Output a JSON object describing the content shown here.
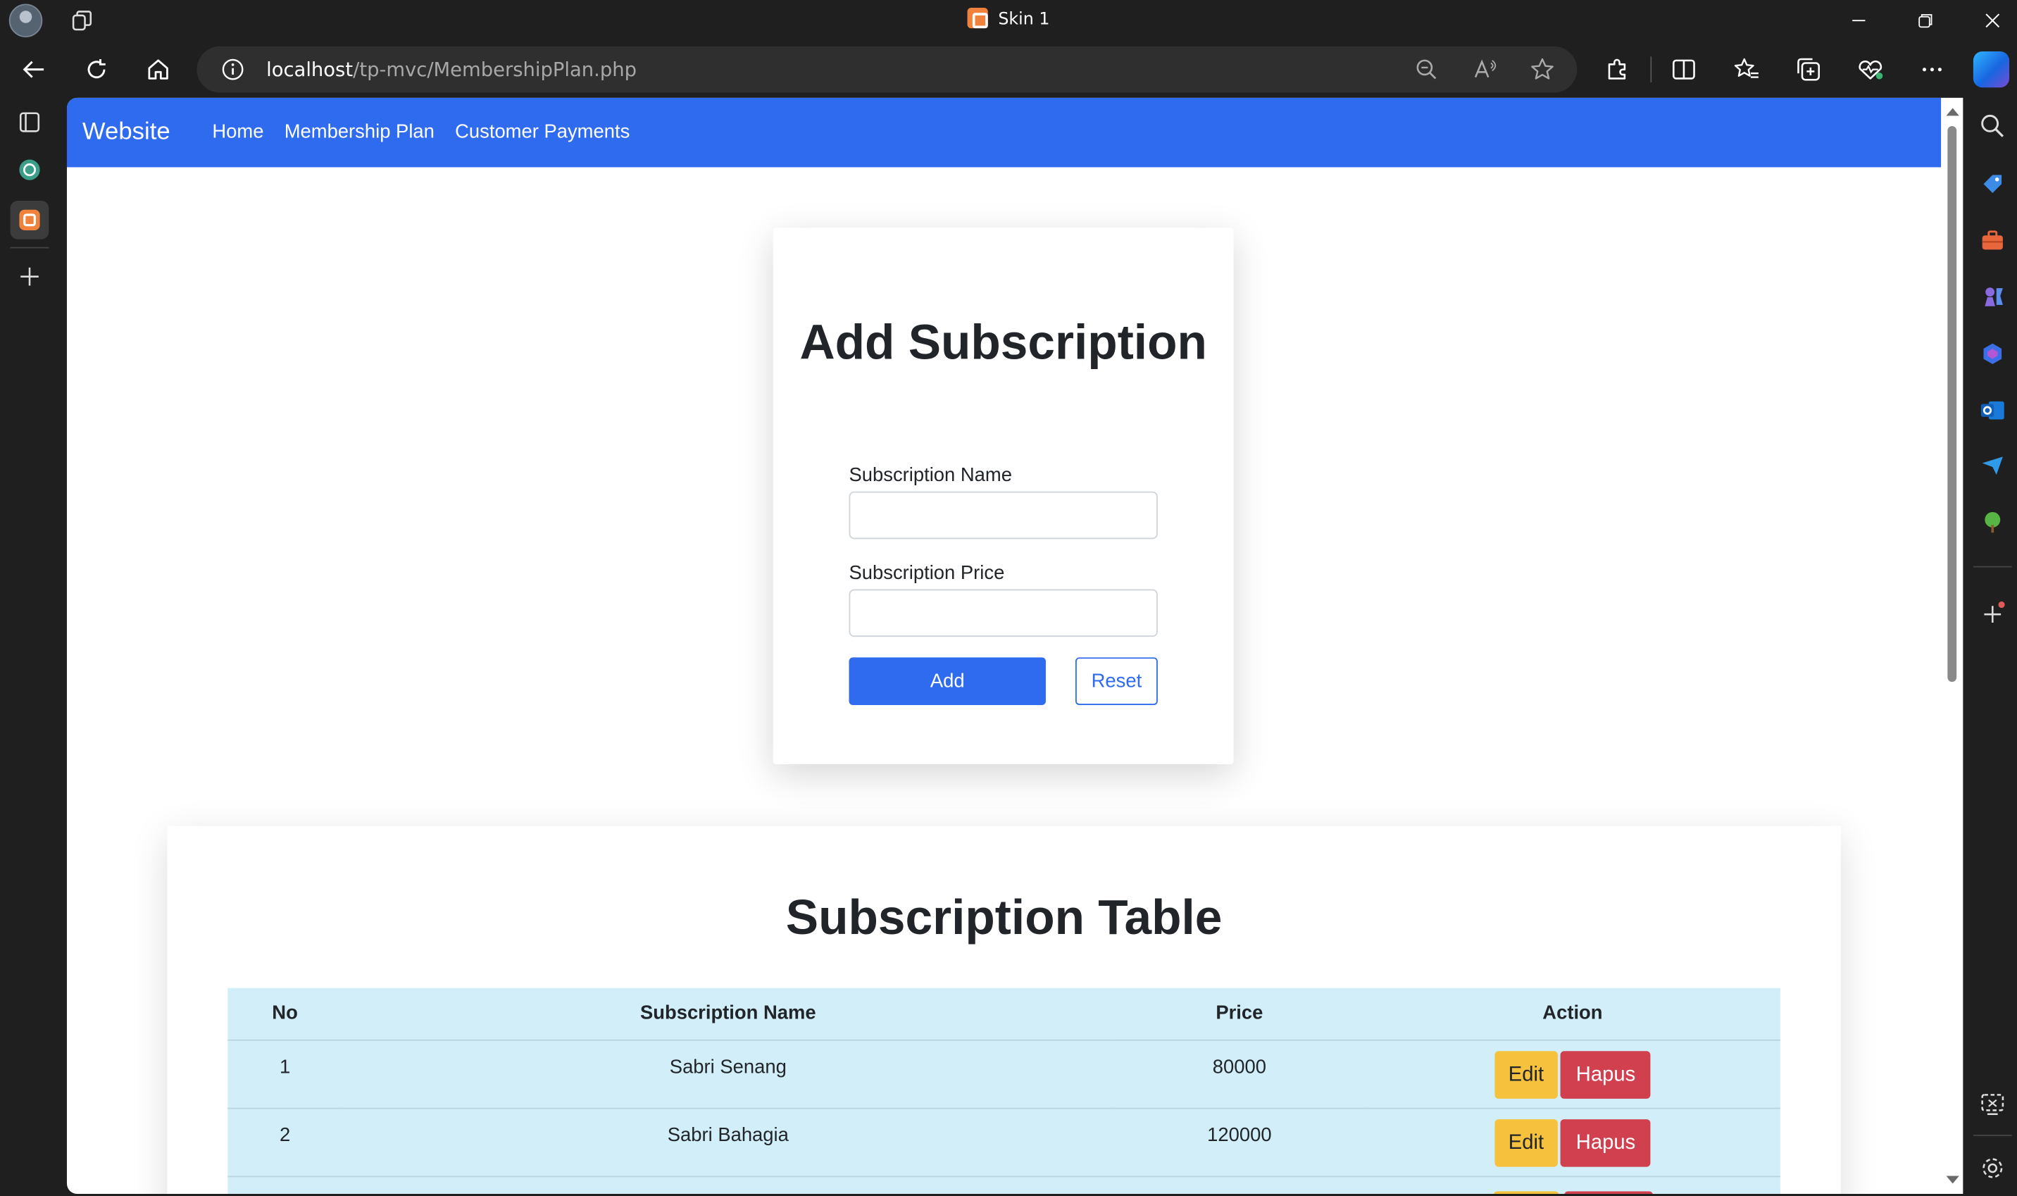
{
  "window": {
    "title": "Skin 1"
  },
  "browser": {
    "url_host": "localhost",
    "url_path": "/tp-mvc/MembershipPlan.php"
  },
  "navbar": {
    "brand": "Website",
    "links": [
      "Home",
      "Membership Plan",
      "Customer Payments"
    ]
  },
  "form": {
    "title": "Add Subscription",
    "name_label": "Subscription Name",
    "name_value": "",
    "price_label": "Subscription Price",
    "price_value": "",
    "add_label": "Add",
    "reset_label": "Reset"
  },
  "table": {
    "title": "Subscription Table",
    "headers": [
      "No",
      "Subscription Name",
      "Price",
      "Action"
    ],
    "rows": [
      {
        "no": "1",
        "name": "Sabri Senang",
        "price": "80000",
        "edit": "Edit",
        "delete": "Hapus"
      },
      {
        "no": "2",
        "name": "Sabri Bahagia",
        "price": "120000",
        "edit": "Edit",
        "delete": "Hapus"
      }
    ]
  },
  "colors": {
    "primary": "#2f6bef",
    "table_bg": "#d2eff9",
    "edit": "#f6c23e",
    "delete": "#d1404f",
    "chrome": "#1f1f1f"
  }
}
